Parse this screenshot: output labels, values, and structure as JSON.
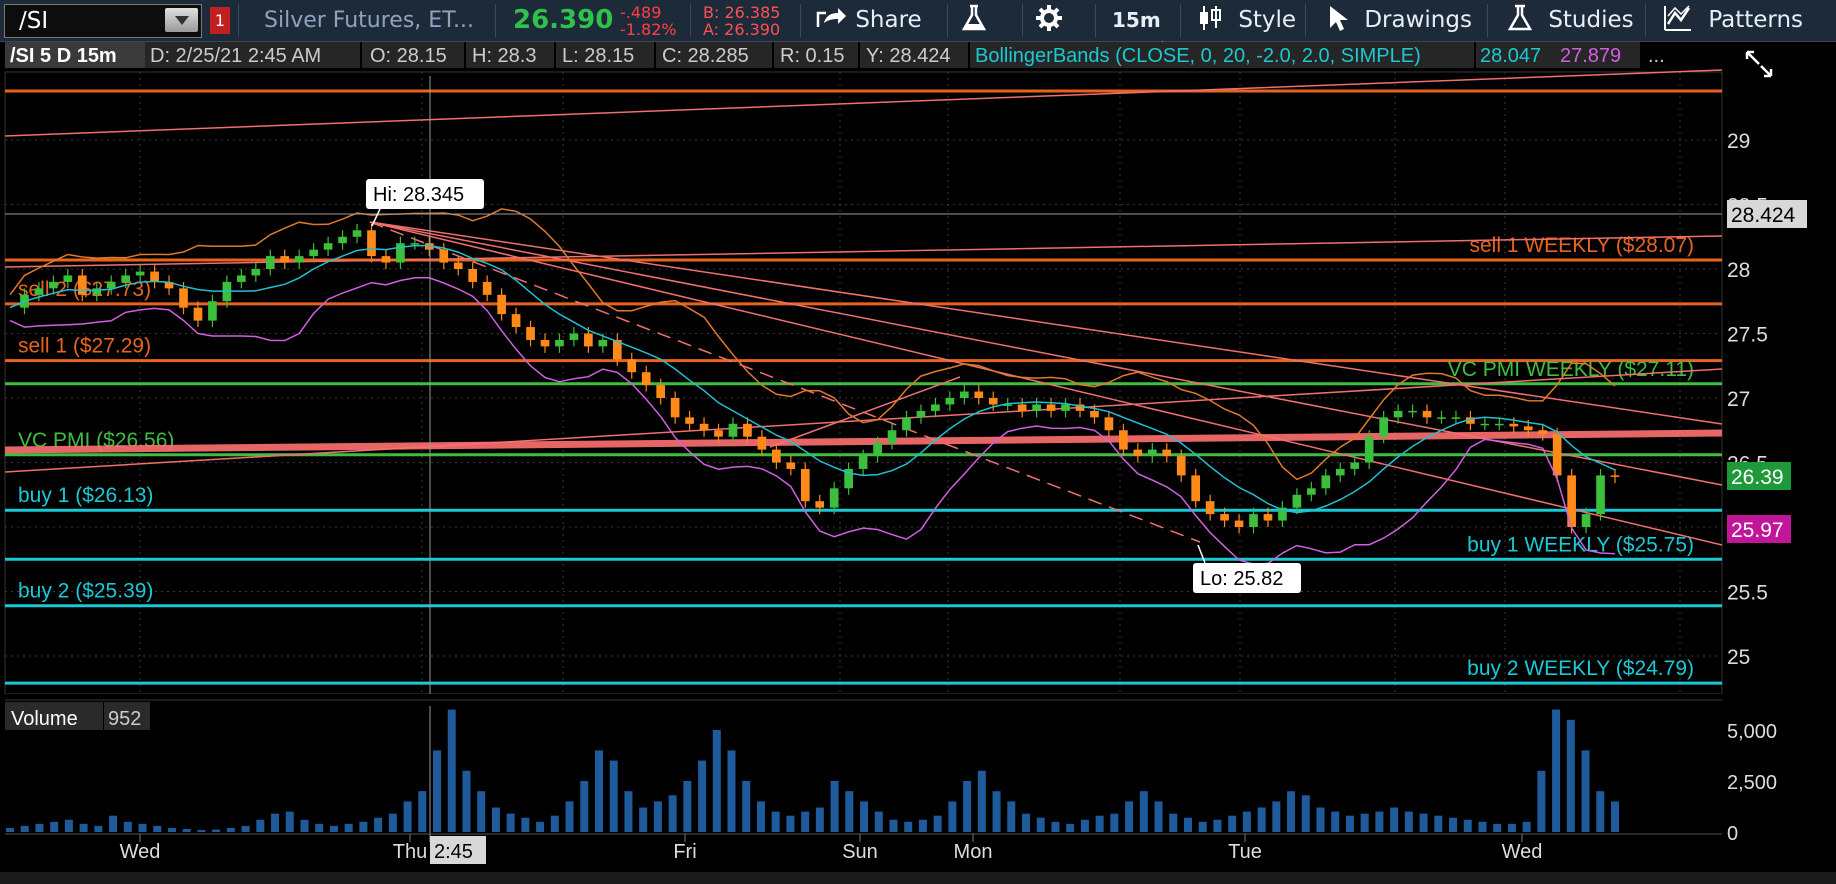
{
  "toolbar": {
    "symbol": "/SI",
    "alert_badge": "1",
    "description": "Silver Futures, ET...",
    "last": "26.390",
    "net_change": "-.489",
    "pct_change": "-1.82%",
    "bid": "B: 26.385",
    "ask": "A: 26.390",
    "share_label": "Share",
    "timeframe_label": "15m",
    "style_label": "Style",
    "drawings_label": "Drawings",
    "studies_label": "Studies",
    "patterns_label": "Patterns"
  },
  "header": {
    "symbol_period": "/SI 5 D 15m",
    "date": "D: 2/25/21 2:45 AM",
    "open": "O: 28.15",
    "high": "H: 28.3",
    "low": "L: 28.15",
    "close": "C: 28.285",
    "range": "R: 0.15",
    "y": "Y: 28.424",
    "study": "BollingerBands (CLOSE, 0, 20, -2.0, 2.0, SIMPLE)",
    "upper_band": "28.047",
    "lower_band": "27.879",
    "more": "..."
  },
  "colors": {
    "bg": "#000000",
    "grid": "#3a3a3a",
    "orange": "#e8641e",
    "green": "#3fbf3f",
    "cyan": "#19c9d4",
    "salmon": "#f07070",
    "up_candle": "#3cbf3c",
    "down_candle": "#ff8a1a",
    "bb_mid": "#20c0d0",
    "bb_upper": "#e07a2a",
    "bb_lower": "#d060e0",
    "volume": "#1f5a9a",
    "price_tag_green": "#1e9a3a",
    "price_tag_magenta": "#c2169a"
  },
  "chart_data": {
    "type": "candlestick",
    "x_axis_labels": [
      "Wed",
      "Thu",
      "Fri",
      "Sun",
      "Mon",
      "Tue",
      "Wed"
    ],
    "cursor_time_label": "2:45",
    "y_ticks": [
      "29",
      "28.5",
      "28",
      "27.5",
      "27",
      "26.5",
      "25.5",
      "25"
    ],
    "ylim": [
      24.8,
      29.4
    ],
    "price_tags": {
      "crosshair": "28.424",
      "last": "26.39",
      "lower": "25.97"
    },
    "annotations": {
      "high": "Hi: 28.345",
      "low": "Lo: 25.82"
    },
    "levels": [
      {
        "label": "sell 1 WEEKLY ($28.07)",
        "value": 28.07,
        "color": "orange",
        "side": "right"
      },
      {
        "label": "sell 2 ($27.73)",
        "value": 27.73,
        "color": "orange",
        "side": "left"
      },
      {
        "label": "sell 1 ($27.29)",
        "value": 27.29,
        "color": "orange",
        "side": "left"
      },
      {
        "label": "VC PMI WEEKLY ($27.11)",
        "value": 27.11,
        "color": "green",
        "side": "right"
      },
      {
        "label": "VC PMI ($26.56)",
        "value": 26.56,
        "color": "green",
        "side": "left"
      },
      {
        "label": "buy 1 ($26.13)",
        "value": 26.13,
        "color": "cyan",
        "side": "left"
      },
      {
        "label": "buy 1 WEEKLY ($25.75)",
        "value": 25.75,
        "color": "cyan",
        "side": "right"
      },
      {
        "label": "buy 2 ($25.39)",
        "value": 25.39,
        "color": "cyan",
        "side": "left"
      },
      {
        "label": "buy 2 WEEKLY ($24.79)",
        "value": 24.79,
        "color": "cyan",
        "side": "right"
      }
    ],
    "extra_lines": [
      29.38
    ],
    "close_series": [
      27.7,
      27.8,
      27.85,
      27.9,
      27.95,
      27.8,
      27.85,
      27.9,
      27.95,
      27.98,
      27.9,
      27.85,
      27.7,
      27.6,
      27.75,
      27.9,
      27.95,
      28.0,
      28.1,
      28.05,
      28.1,
      28.15,
      28.2,
      28.25,
      28.3,
      28.1,
      28.05,
      28.2,
      28.2,
      28.15,
      28.05,
      28.0,
      27.9,
      27.8,
      27.65,
      27.55,
      27.45,
      27.4,
      27.45,
      27.5,
      27.4,
      27.45,
      27.3,
      27.2,
      27.1,
      27.0,
      26.85,
      26.8,
      26.75,
      26.7,
      26.8,
      26.7,
      26.6,
      26.5,
      26.45,
      26.2,
      26.15,
      26.3,
      26.45,
      26.55,
      26.65,
      26.75,
      26.85,
      26.9,
      26.95,
      27.0,
      27.05,
      27.0,
      26.95,
      26.95,
      26.9,
      26.95,
      26.9,
      26.95,
      26.9,
      26.85,
      26.75,
      26.6,
      26.55,
      26.6,
      26.55,
      26.4,
      26.2,
      26.1,
      26.05,
      26.0,
      26.1,
      26.05,
      26.15,
      26.25,
      26.3,
      26.4,
      26.45,
      26.5,
      26.7,
      26.85,
      26.9,
      26.9,
      26.85,
      26.85,
      26.85,
      26.8,
      26.8,
      26.8,
      26.78,
      26.75,
      26.72,
      26.4,
      26.0,
      26.1,
      26.4,
      26.39
    ],
    "volume_ticks": [
      "5,000",
      "2,500",
      "0"
    ],
    "volume_label": "Volume",
    "volume_value": "952",
    "volume_series": [
      200,
      300,
      400,
      500,
      600,
      400,
      300,
      800,
      500,
      400,
      300,
      200,
      150,
      100,
      120,
      200,
      300,
      600,
      900,
      1000,
      600,
      400,
      300,
      400,
      500,
      700,
      900,
      1500,
      2000,
      4000,
      6000,
      3000,
      2000,
      1200,
      900,
      700,
      500,
      800,
      1500,
      2500,
      4000,
      3500,
      2000,
      1200,
      1500,
      1800,
      2500,
      3500,
      5000,
      4000,
      2500,
      1500,
      1000,
      800,
      1000,
      1200,
      2500,
      2000,
      1500,
      1000,
      600,
      500,
      600,
      800,
      1500,
      2500,
      3000,
      2000,
      1500,
      900,
      700,
      500,
      400,
      600,
      800,
      900,
      1500,
      2000,
      1500,
      900,
      700,
      500,
      600,
      800,
      1000,
      1200,
      1500,
      2000,
      1800,
      1200,
      1000,
      800,
      900,
      1000,
      1200,
      1000,
      900,
      800,
      700,
      600,
      500,
      400,
      400,
      500,
      3000,
      6000,
      5500,
      4000,
      2000,
      1500
    ]
  }
}
